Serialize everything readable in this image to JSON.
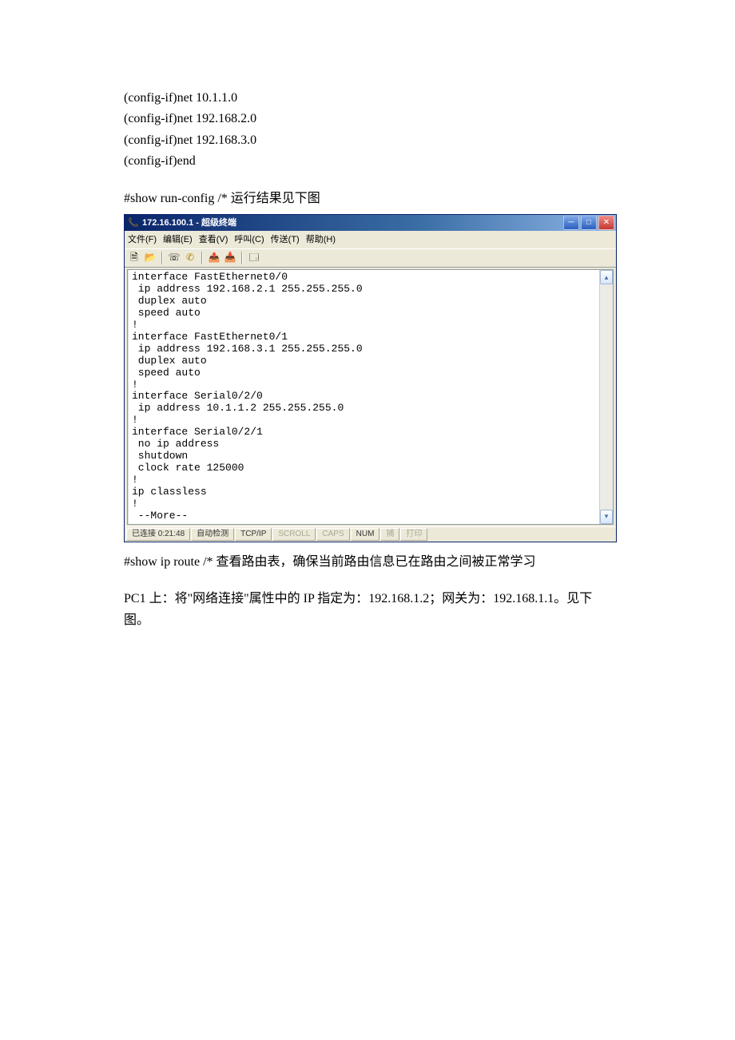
{
  "doc": {
    "line1": "(config-if)net 10.1.1.0",
    "line2": "(config-if)net 192.168.2.0",
    "line3": "(config-if)net 192.168.3.0",
    "line4": "(config-if)end",
    "show_run": "#show run-config     /*    运行结果见下图",
    "show_route": "#show ip route      /*      查看路由表，确保当前路由信息已在路由之间被正常学习",
    "pc1": "PC1 上：将\"网络连接\"属性中的 IP 指定为：192.168.1.2；网关为：192.168.1.1。见下图。"
  },
  "ht": {
    "title": "172.16.100.1 - 超级终端",
    "menus": {
      "file": "文件(F)",
      "edit": "编辑(E)",
      "view": "查看(V)",
      "call": "呼叫(C)",
      "transfer": "传送(T)",
      "help": "帮助(H)"
    },
    "terminal_output": "interface FastEthernet0/0\n ip address 192.168.2.1 255.255.255.0\n duplex auto\n speed auto\n!\ninterface FastEthernet0/1\n ip address 192.168.3.1 255.255.255.0\n duplex auto\n speed auto\n!\ninterface Serial0/2/0\n ip address 10.1.1.2 255.255.255.0\n!\ninterface Serial0/2/1\n no ip address\n shutdown\n clock rate 125000\n!\nip classless\n!\n --More--",
    "status": {
      "connected": "已连接 0:21:48",
      "auto": "自动检测",
      "tcpip": "TCP/IP",
      "scroll": "SCROLL",
      "caps": "CAPS",
      "num": "NUM",
      "capture": "捕",
      "print": "打印"
    }
  }
}
